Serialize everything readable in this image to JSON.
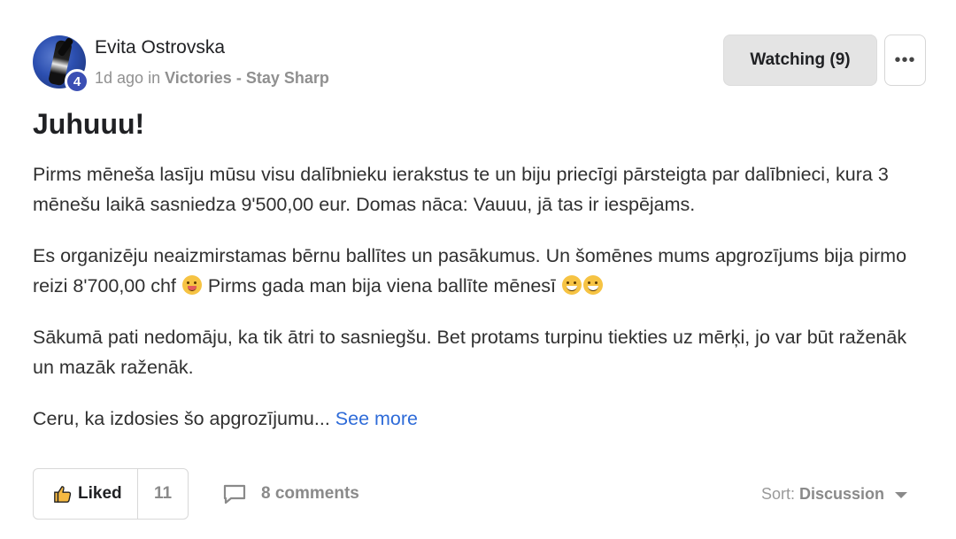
{
  "post": {
    "author": "Evita Ostrovska",
    "level": "4",
    "time": "1d ago",
    "in_word": "in",
    "category": "Victories - Stay Sharp",
    "watch_label": "Watching (9)",
    "more_label": "•••",
    "title": "Juhuuu!",
    "paragraphs": [
      "Pirms mēneša lasīju mūsu visu dalībnieku ierakstus te un biju priecīgi pārsteigta par dalībnieci, kura 3 mēnešu laikā sasniedza 9'500,00 eur. Domas nāca: Vauuu, jā tas ir iespējams.",
      "Es organizēju neaizmirstamas bērnu ballītes un pasākumus. Un šomēnes mums apgrozījums bija pirmo reizi 8'700,00 chf",
      "Pirms gada man bija viena ballīte mēnesī",
      "Sākumā pati nedomāju, ka tik ātri to sasniegšu. Bet protams turpinu tiekties uz mērķi, jo var būt raženāk un mazāk raženāk.",
      "Ceru, ka izdosies šo apgrozījumu..."
    ],
    "see_more": "See more"
  },
  "footer": {
    "like_label": "Liked",
    "like_count": "11",
    "comments_label": "8 comments",
    "sort_label": "Sort:",
    "sort_value": "Discussion"
  },
  "icons": {
    "avatar": "avatar-photo",
    "thumb": "thumbs-up-icon",
    "comment": "comment-bubble-icon",
    "caret": "chevron-down-icon",
    "emoji_party": "partying-face-emoji",
    "emoji_sweat": "grinning-sweat-emoji"
  },
  "colors": {
    "link": "#2e6bd8",
    "badge": "#3b4fb4",
    "watch_bg": "#e4e4e4"
  }
}
